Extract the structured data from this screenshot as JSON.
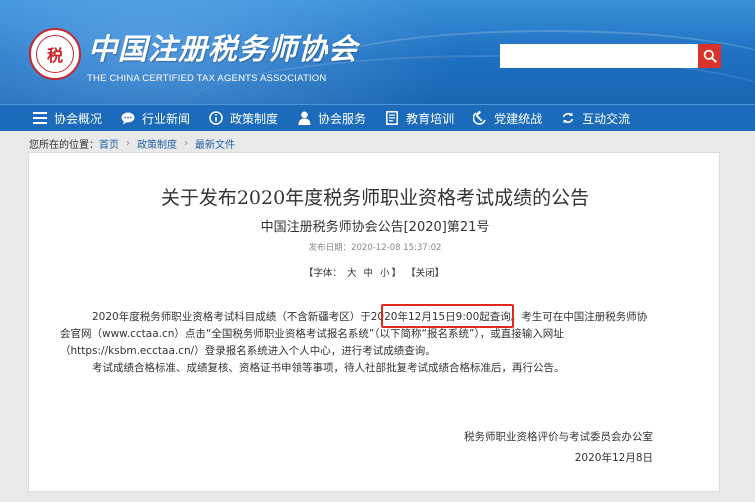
{
  "header": {
    "emblem_text": "税",
    "logo_cn": "中国注册税务师协会",
    "logo_en": "THE CHINA CERTIFIED TAX AGENTS ASSOCIATION",
    "search": {
      "placeholder": "",
      "value": ""
    }
  },
  "nav": {
    "items": [
      {
        "label": "协会概况",
        "icon": "menu-icon"
      },
      {
        "label": "行业新闻",
        "icon": "chat-bubble-icon"
      },
      {
        "label": "政策制度",
        "icon": "info-circle-icon"
      },
      {
        "label": "协会服务",
        "icon": "person-icon"
      },
      {
        "label": "教育培训",
        "icon": "document-icon"
      },
      {
        "label": "党建统战",
        "icon": "hammer-sickle-icon"
      },
      {
        "label": "互动交流",
        "icon": "exchange-icon"
      }
    ]
  },
  "breadcrumb": {
    "prefix": "您所在的位置：",
    "items": [
      "首页",
      "政策制度",
      "最新文件"
    ]
  },
  "article": {
    "title": "关于发布2020年度税务师职业资格考试成绩的公告",
    "subtitle": "中国注册税务师协会公告[2020]第21号",
    "publish_date": "发布日期：2020-12-08 15:37:02",
    "font_controls": {
      "open": "【",
      "label": "字体：",
      "large": "大",
      "medium": "中",
      "small": "小",
      "close_bracket": "】",
      "close_label": "【关闭】"
    },
    "para1_line1_pre": "2020年度税务师职业资格考试科目成绩（不含新疆考区）于",
    "para1_line1_highlight": "2020年12月15日9:00起查询。",
    "para1_line1_post": "考生可在中国注册税务师协",
    "para1_line2": "会官网（www.cctaa.cn）点击“全国税务师职业资格考试报名系统”（以下简称“报名系统”），或直接输入网址",
    "para1_line3": "（https://ksbm.ecctaa.cn/）登录报名系统进入个人中心，进行考试成绩查询。",
    "para2": "考试成绩合格标准、成绩复核、资格证书申领等事项，待人社部批复考试成绩合格标准后，再行公告。",
    "signature": "税务师职业资格评价与考试委员会办公室",
    "sign_date": "2020年12月8日"
  },
  "colors": {
    "header_blue": "#1e6fc0",
    "nav_blue": "#1c6bba",
    "search_red": "#d8332b",
    "highlight_red": "#e0281f",
    "link_blue": "#2460a8"
  }
}
